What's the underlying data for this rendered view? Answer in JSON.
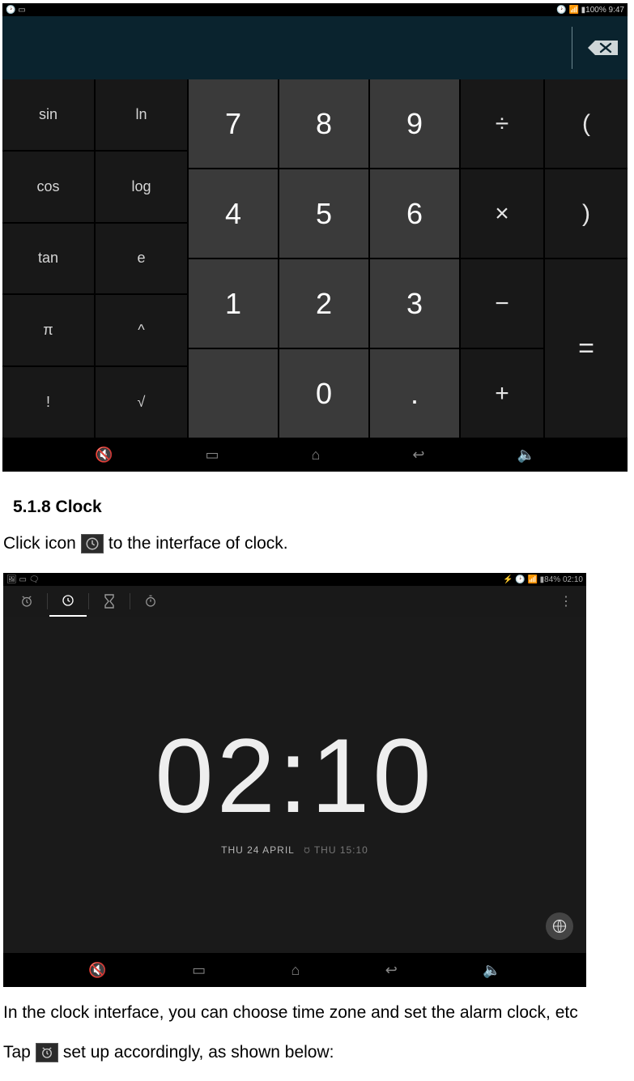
{
  "calc": {
    "statusbar": {
      "left_icons": "🕑 ▭",
      "right_text": "🕑 📶 ▮100% 9:47"
    },
    "fn_keys": [
      "sin",
      "ln",
      "cos",
      "log",
      "tan",
      "e",
      "π",
      "^",
      "!",
      "√"
    ],
    "num_keys": [
      "7",
      "8",
      "9",
      "4",
      "5",
      "6",
      "1",
      "2",
      "3",
      "",
      "0",
      "."
    ],
    "op_keys": {
      "div": "÷",
      "lparen": "(",
      "mul": "×",
      "rparen": ")",
      "sub": "−",
      "add": "+",
      "eq": "="
    },
    "nav_icons": [
      "🔇",
      "▭",
      "⌂",
      "↩",
      "🔈"
    ]
  },
  "doc": {
    "heading": "5.1.8 Clock",
    "line1_pre": "Click icon",
    "line1_post": " to the interface of clock.",
    "line2": "In the clock interface, you can choose time zone and set the alarm clock, etc",
    "line3_pre": "Tap",
    "line3_post": " set up accordingly, as shown below:"
  },
  "clock": {
    "statusbar": {
      "left_icons": "🖼 ▭ 🗨",
      "right_text": "⚡ 🕑 📶 ▮84% 02:10"
    },
    "time": "02:10",
    "date_main": "THU 24 APRIL",
    "date_alt": "THU 15:10",
    "nav_icons": [
      "🔇",
      "▭",
      "⌂",
      "↩",
      "🔈"
    ]
  }
}
